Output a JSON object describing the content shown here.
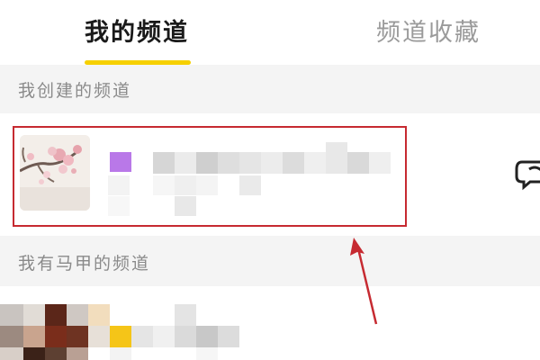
{
  "tabs": {
    "mine_label": "我的频道",
    "favorites_label": "频道收藏",
    "active": "mine_label"
  },
  "sections": {
    "created_label": "我创建的频道",
    "alt_label": "我有马甲的频道"
  },
  "colors": {
    "accent_underline": "#f6d000",
    "highlight_border": "#c62a31",
    "channel_tag": "#b978e8"
  },
  "icons": {
    "chat": "chat-bubble-icon"
  }
}
